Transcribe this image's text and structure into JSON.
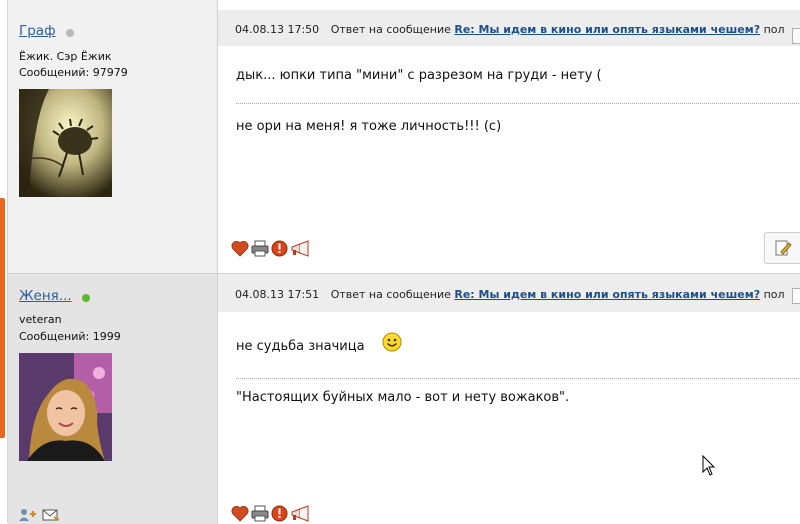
{
  "posts": [
    {
      "author": {
        "name": "Граф",
        "status": "offline",
        "rank": "Ёжик. Сэр Ёжик",
        "posts_label": "Сообщений: 97979",
        "avatar_icon": "hedgehog-in-fog-avatar"
      },
      "meta": {
        "datetime": "04.08.13 17:50",
        "reply_to_label": "Ответ на сообщение",
        "reply_to_link": "Re: Мы идем в кино или опять языками чешем?",
        "trailing": "пол"
      },
      "body": "дык... юпки типа \"мини\" с разрезом на груди - нету (",
      "signature": "не ори на меня! я тоже личность!!! (c)"
    },
    {
      "author": {
        "name": "Женя...",
        "status": "online",
        "rank": "veteran",
        "posts_label": "Сообщений: 1999",
        "avatar_icon": "woman-portrait-avatar"
      },
      "meta": {
        "datetime": "04.08.13 17:51",
        "reply_to_label": "Ответ на сообщение",
        "reply_to_link": "Re: Мы идем в кино или опять языками чешем?",
        "trailing": "пол"
      },
      "body": "не судьба значица",
      "body_emoticon": "smiley-icon",
      "signature": "\"Настоящих буйных мало - вот и нету вожаков\"."
    }
  ],
  "colors": {
    "link": "#2a5ea0",
    "meta_link": "#1f4f8a",
    "online": "#5cb82e",
    "offline": "#b8b8b8",
    "accent_tab": "#e8661e"
  },
  "action_icons": [
    "heart-icon",
    "print-icon",
    "report-icon",
    "megaphone-icon"
  ]
}
